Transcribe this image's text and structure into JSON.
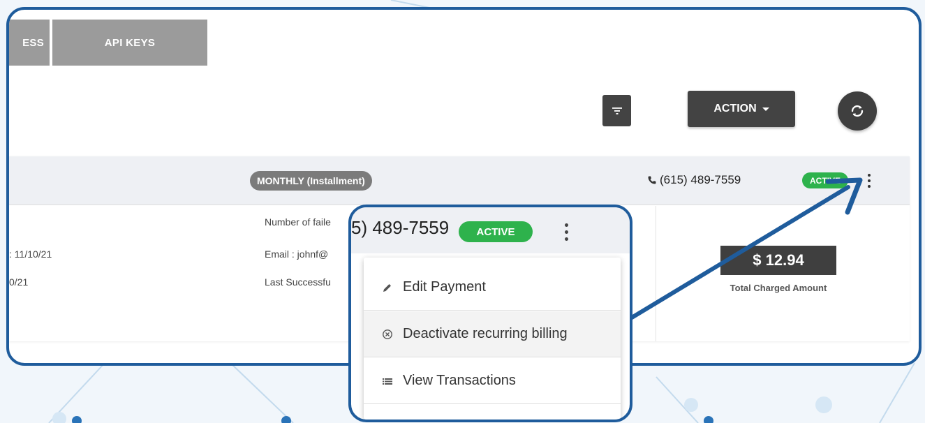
{
  "tabs": [
    {
      "label": "ESS"
    },
    {
      "label": "API KEYS"
    }
  ],
  "toolbar": {
    "action_label": "ACTION",
    "filter_icon": "filter-icon",
    "refresh_icon": "refresh-icon"
  },
  "card": {
    "plan_badge": "MONTHLY (Installment)",
    "phone": "(615) 489-7559",
    "status": "ACTIVE",
    "left_lines": [
      ": 11/10/21",
      "0/21"
    ],
    "middle_lines": [
      "Number of faile",
      "Email : johnf@",
      "Last Successfu"
    ],
    "amount": "$ 12.94",
    "amount_label": "Total Charged Amount"
  },
  "zoom": {
    "phone": "5) 489-7559",
    "status": "ACTIVE",
    "menu": [
      {
        "label": "Edit Payment",
        "icon": "pencil-icon"
      },
      {
        "label": "Deactivate recurring billing",
        "icon": "circle-x-icon"
      },
      {
        "label": "View Transactions",
        "icon": "list-icon"
      }
    ]
  },
  "colors": {
    "frame": "#1f5c9c",
    "active": "#2eb24c",
    "dark_button": "#434343",
    "tab": "#9b9b9b"
  }
}
